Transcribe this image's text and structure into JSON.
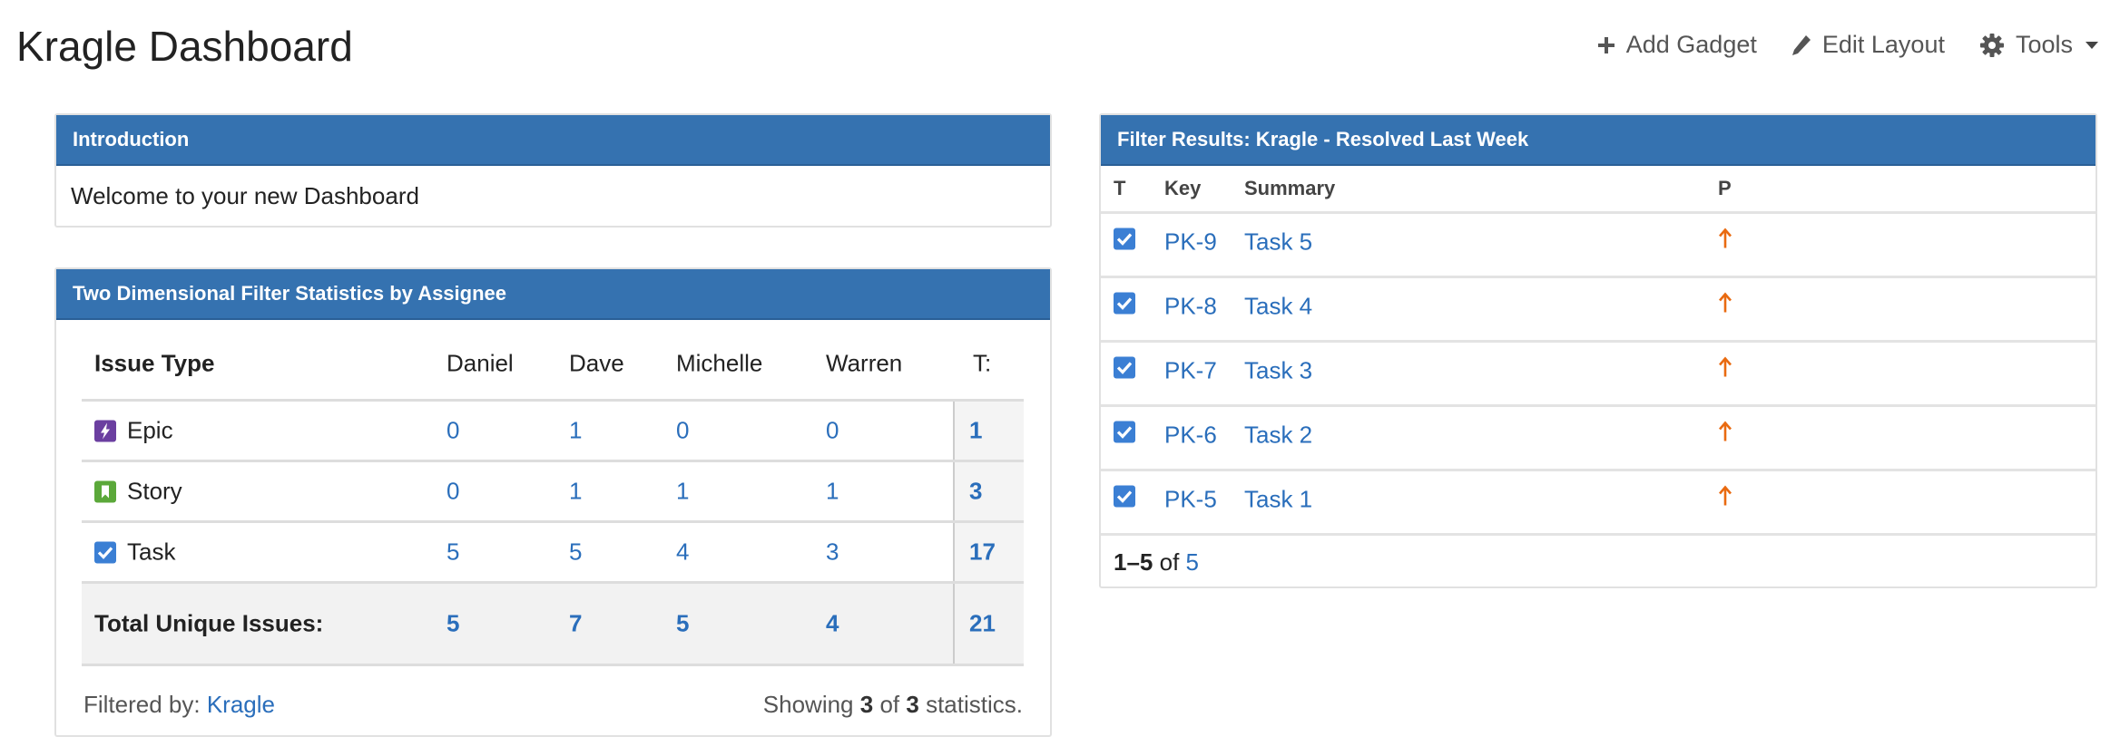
{
  "header": {
    "title": "Kragle Dashboard",
    "actions": [
      {
        "label": "Add Gadget",
        "icon": "plus-icon"
      },
      {
        "label": "Edit Layout",
        "icon": "pencil-icon"
      },
      {
        "label": "Tools",
        "icon": "gear-icon"
      }
    ]
  },
  "intro": {
    "title": "Introduction",
    "text": "Welcome to your new Dashboard"
  },
  "stats": {
    "title": "Two Dimensional Filter Statistics by Assignee",
    "columns": [
      "Issue Type",
      "Daniel",
      "Dave",
      "Michelle",
      "Warren",
      "T:"
    ],
    "rows": [
      {
        "type": "Epic",
        "icon": "epic-icon",
        "values": [
          "0",
          "1",
          "0",
          "0"
        ],
        "total": "1"
      },
      {
        "type": "Story",
        "icon": "story-icon",
        "values": [
          "0",
          "1",
          "1",
          "1"
        ],
        "total": "3"
      },
      {
        "type": "Task",
        "icon": "task-icon",
        "values": [
          "5",
          "5",
          "4",
          "3"
        ],
        "total": "17"
      }
    ],
    "totals": {
      "label": "Total Unique Issues:",
      "values": [
        "5",
        "7",
        "5",
        "4"
      ],
      "total": "21"
    },
    "footer": {
      "filtered_label": "Filtered by:",
      "filter_name": "Kragle",
      "showing_prefix": "Showing",
      "shown": "3",
      "of": "of",
      "count": "3",
      "showing_suffix": "statistics."
    }
  },
  "results": {
    "title": "Filter Results: Kragle - Resolved Last Week",
    "columns": [
      "T",
      "Key",
      "Summary",
      "P"
    ],
    "rows": [
      {
        "key": "PK-9",
        "summary": "Task 5",
        "type": "task-icon",
        "priority": "major-priority-icon"
      },
      {
        "key": "PK-8",
        "summary": "Task 4",
        "type": "task-icon",
        "priority": "major-priority-icon"
      },
      {
        "key": "PK-7",
        "summary": "Task 3",
        "type": "task-icon",
        "priority": "major-priority-icon"
      },
      {
        "key": "PK-6",
        "summary": "Task 2",
        "type": "task-icon",
        "priority": "major-priority-icon"
      },
      {
        "key": "PK-5",
        "summary": "Task 1",
        "type": "task-icon",
        "priority": "major-priority-icon"
      }
    ],
    "pagination": {
      "range": "1–5",
      "of": "of",
      "total": "5"
    }
  },
  "colors": {
    "header_blue": "#3572b0",
    "link_blue": "#2a6ebb",
    "priority_orange": "#e96a10",
    "epic_purple": "#6b3fa0",
    "story_green": "#5ba83a",
    "task_blue": "#3b7fd4"
  }
}
